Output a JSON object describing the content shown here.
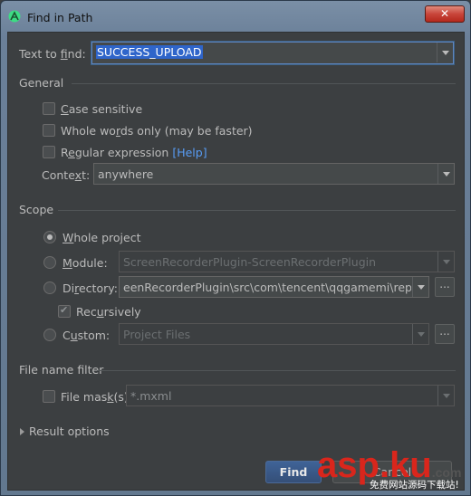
{
  "window": {
    "title": "Find in Path",
    "close_label": "✕"
  },
  "search": {
    "label_pre": "Text to ",
    "label_u": "f",
    "label_post": "ind:",
    "value": "SUCCESS_UPLOAD"
  },
  "general": {
    "title": "General",
    "case_sensitive": {
      "label_pre": "",
      "label_u": "C",
      "label_post": "ase sensitive",
      "checked": false
    },
    "whole_words": {
      "label_pre": "Whole wo",
      "label_u": "r",
      "label_post": "ds only (may be faster)",
      "checked": false
    },
    "regex": {
      "label_pre": "R",
      "label_u": "e",
      "label_post": "gular expression",
      "checked": false,
      "help": "[Help]"
    },
    "context": {
      "label_pre": "Conte",
      "label_u": "x",
      "label_post": "t:",
      "value": "anywhere"
    }
  },
  "scope": {
    "title": "Scope",
    "whole_project": {
      "label_pre": "",
      "label_u": "W",
      "label_post": "hole project",
      "selected": true
    },
    "module": {
      "label_pre": "",
      "label_u": "M",
      "label_post": "odule:",
      "value": "ScreenRecorderPlugin-ScreenRecorderPlugin",
      "selected": false
    },
    "directory": {
      "label_pre": "Di",
      "label_u": "r",
      "label_post": "ectory:",
      "value": "eenRecorderPlugin\\src\\com\\tencent\\qqgamemi\\report",
      "selected": false,
      "browse": "..."
    },
    "recursively": {
      "label_pre": "Rec",
      "label_u": "u",
      "label_post": "rsively",
      "checked": true
    },
    "custom": {
      "label_pre": "C",
      "label_u": "u",
      "label_post": "stom:",
      "value": "Project Files",
      "selected": false,
      "browse": "..."
    }
  },
  "filter": {
    "title": "File name filter",
    "file_mask": {
      "label_pre": "File mas",
      "label_u": "k",
      "label_post": "(s)",
      "value": "*.mxml",
      "checked": false
    }
  },
  "result_options": {
    "label": "Result options"
  },
  "buttons": {
    "find": "Find",
    "cancel": "Cancel"
  },
  "watermark": {
    "part1": "asp",
    "dot": ".",
    "part2": "ku",
    "tld": ".com",
    "sub": "免费网站源码下载站!"
  },
  "colors": {
    "accent": "#2f65ca",
    "link": "#589df6",
    "background": "#3c3f41",
    "watermark_red": "#d9261c"
  }
}
